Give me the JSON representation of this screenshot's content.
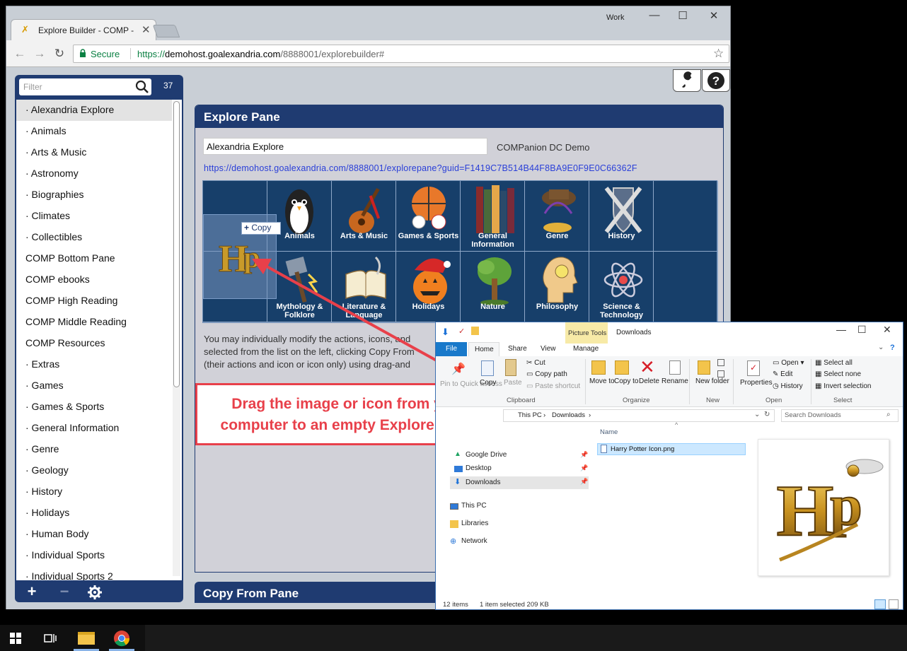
{
  "window": {
    "tab_title": "Explore Builder - COMP -",
    "profile": "Work",
    "min": "—",
    "max": "☐",
    "close": "✕"
  },
  "toolbar": {
    "secure_label": "Secure",
    "url_scheme": "https://",
    "url_host": "demohost.goalexandria.com",
    "url_path": "/8888001/explorebuilder#"
  },
  "sidebar": {
    "filter_placeholder": "Filter",
    "count": "37",
    "items": [
      "· Alexandria Explore",
      "· Animals",
      "· Arts & Music",
      "· Astronomy",
      "· Biographies",
      "· Climates",
      "· Collectibles",
      "COMP Bottom Pane",
      "COMP ebooks",
      "COMP High Reading",
      "COMP Middle Reading",
      "COMP Resources",
      "· Extras",
      "· Games",
      "· Games & Sports",
      "· General Information",
      "· Genre",
      "· Geology",
      "· History",
      "· Holidays",
      "· Human Body",
      "· Individual Sports",
      "· Individual Sports 2"
    ]
  },
  "explore_pane": {
    "title": "Explore Pane",
    "name_value": "Alexandria Explore",
    "companion_label": "COMPanion DC Demo",
    "guid_link": "https://demohost.goalexandria.com/8888001/explorepane?guid=F1419C7B514B44F8BA9E0F9E0C66362F",
    "tiles_row1": [
      "",
      "Animals",
      "Arts & Music",
      "Games & Sports",
      "General Information",
      "Genre",
      "History",
      ""
    ],
    "tiles_row2": [
      "",
      "Mythology & Folklore",
      "Literature & Language",
      "Holidays",
      "Nature",
      "Philosophy",
      "Science & Technology",
      ""
    ],
    "desc_line1": "You may individually modify the actions, icons, and",
    "desc_line2": "selected from the list on the left, clicking Copy From",
    "desc_line3": "(their actions and icon or icon only) using drag-and"
  },
  "drag": {
    "copy_label": "Copy"
  },
  "copy_from_pane": {
    "title": "Copy From Pane"
  },
  "callout": {
    "line1": "Drag the image or icon from your",
    "line2": "computer to an empty Explore pane."
  },
  "explorer": {
    "picture_tools": "Picture Tools",
    "title": "Downloads",
    "tabs": [
      "File",
      "Home",
      "Share",
      "View",
      "Manage"
    ],
    "ribbon": {
      "pin": "Pin to Quick access",
      "copy": "Copy",
      "paste": "Paste",
      "cut": "Cut",
      "copy_path": "Copy path",
      "paste_shortcut": "Paste shortcut",
      "move_to": "Move to",
      "copy_to": "Copy to",
      "delete": "Delete",
      "rename": "Rename",
      "new_folder": "New folder",
      "properties": "Properties",
      "open": "Open",
      "edit": "Edit",
      "history": "History",
      "select_all": "Select all",
      "select_none": "Select none",
      "invert_selection": "Invert selection",
      "group_clipboard": "Clipboard",
      "group_organize": "Organize",
      "group_new": "New",
      "group_open": "Open",
      "group_select": "Select"
    },
    "breadcrumb_this_pc": "This PC",
    "breadcrumb_downloads": "Downloads",
    "search_placeholder": "Search Downloads",
    "column_name": "Name",
    "nav_items": [
      "Google Drive",
      "Desktop",
      "Downloads",
      "This PC",
      "Libraries",
      "Network"
    ],
    "file_name": "Harry Potter Icon.png",
    "status_items": "12 items",
    "status_selected": "1 item selected  209 KB"
  },
  "colors": {
    "navy": "#1f3b71",
    "accent_red": "#e8404a",
    "tile_bg": "#173f6a"
  }
}
